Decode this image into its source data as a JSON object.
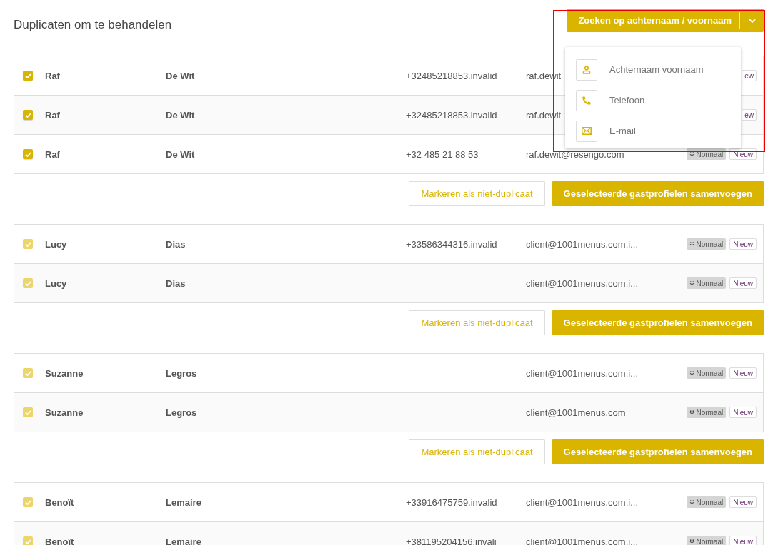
{
  "title": "Duplicaten om te behandelen",
  "search": {
    "label": "Zoeken op achternaam / voornaam",
    "menu_open": true,
    "highlighted": true,
    "items": [
      {
        "kind": "person",
        "label": "Achternaam voornaam"
      },
      {
        "kind": "phone",
        "label": "Telefoon"
      },
      {
        "kind": "mail",
        "label": "E-mail"
      }
    ]
  },
  "groups": [
    {
      "rows": [
        {
          "checked": true,
          "disabled": false,
          "first_name": "Raf",
          "last_name": "De Wit",
          "phone": "+32485218853.invalid",
          "email": "raf.dewit",
          "tags": [
            {
              "kind": "new",
              "label": "ew"
            }
          ]
        },
        {
          "checked": true,
          "disabled": false,
          "first_name": "Raf",
          "last_name": "De Wit",
          "phone": "+32485218853.invalid",
          "email": "raf.dewit",
          "tags": [
            {
              "kind": "new",
              "label": "ew"
            }
          ]
        },
        {
          "checked": true,
          "disabled": false,
          "first_name": "Raf",
          "last_name": "De Wit",
          "phone": "+32 485 21 88 53",
          "email": "raf.dewit@resengo.com",
          "tags": [
            {
              "kind": "level",
              "label": "Normaal"
            },
            {
              "kind": "new",
              "label": "Nieuw"
            }
          ]
        }
      ],
      "actions": [
        "Markeren als niet-duplicaat",
        "Geselecteerde gastprofielen samenvoegen"
      ]
    },
    {
      "rows": [
        {
          "checked": true,
          "disabled": true,
          "first_name": "Lucy",
          "last_name": "Dias",
          "phone": "+33586344316.invalid",
          "email": "client@1001menus.com.i...",
          "tags": [
            {
              "kind": "level",
              "label": "Normaal"
            },
            {
              "kind": "new",
              "label": "Nieuw"
            }
          ]
        },
        {
          "checked": true,
          "disabled": true,
          "first_name": "Lucy",
          "last_name": "Dias",
          "email": "client@1001menus.com.i...",
          "tags": [
            {
              "kind": "level",
              "label": "Normaal"
            },
            {
              "kind": "new",
              "label": "Nieuw"
            }
          ]
        }
      ],
      "actions": [
        "Markeren als niet-duplicaat",
        "Geselecteerde gastprofielen samenvoegen"
      ]
    },
    {
      "rows": [
        {
          "checked": true,
          "disabled": true,
          "first_name": "Suzanne",
          "last_name": "Legros",
          "email": "client@1001menus.com.i...",
          "tags": [
            {
              "kind": "level",
              "label": "Normaal"
            },
            {
              "kind": "new",
              "label": "Nieuw"
            }
          ]
        },
        {
          "checked": true,
          "disabled": true,
          "first_name": "Suzanne",
          "last_name": "Legros",
          "email": "client@1001menus.com",
          "tags": [
            {
              "kind": "level",
              "label": "Normaal"
            },
            {
              "kind": "new",
              "label": "Nieuw"
            }
          ]
        }
      ],
      "actions": [
        "Markeren als niet-duplicaat",
        "Geselecteerde gastprofielen samenvoegen"
      ]
    },
    {
      "rows": [
        {
          "checked": true,
          "disabled": true,
          "first_name": "Benoït",
          "last_name": "Lemaire",
          "phone": "+33916475759.invalid",
          "email": "client@1001menus.com.i...",
          "tags": [
            {
              "kind": "level",
              "label": "Normaal"
            },
            {
              "kind": "new",
              "label": "Nieuw"
            }
          ]
        },
        {
          "checked": true,
          "disabled": true,
          "first_name": "Benoït",
          "last_name": "Lemaire",
          "phone": "+381195204156.invali",
          "email": "client@1001menus.com.i...",
          "tags": [
            {
              "kind": "level",
              "label": "Normaal"
            },
            {
              "kind": "new",
              "label": "Nieuw"
            }
          ]
        }
      ]
    }
  ]
}
